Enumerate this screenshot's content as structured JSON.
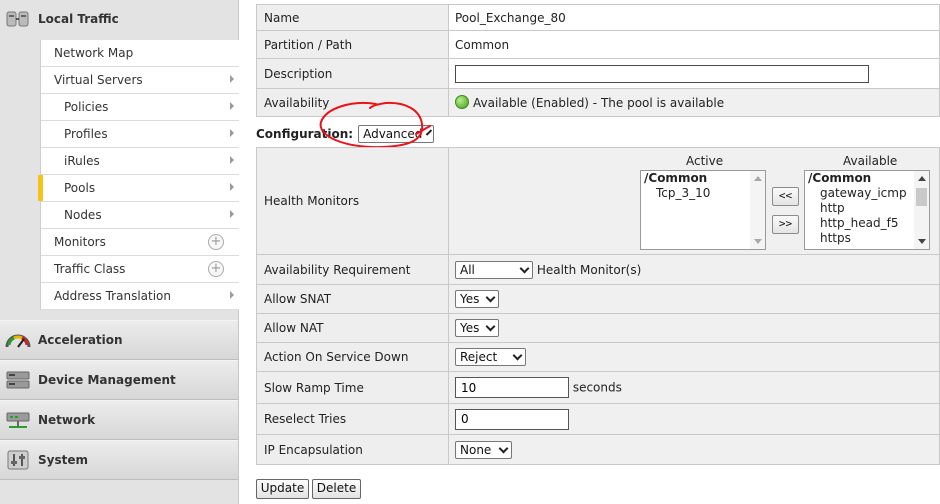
{
  "sidebar": {
    "local_traffic": "Local Traffic",
    "items": [
      {
        "label": "Network Map"
      },
      {
        "label": "Virtual Servers"
      },
      {
        "label": "Policies"
      },
      {
        "label": "Profiles"
      },
      {
        "label": "iRules"
      },
      {
        "label": "Pools"
      },
      {
        "label": "Nodes"
      },
      {
        "label": "Monitors"
      },
      {
        "label": "Traffic Class"
      },
      {
        "label": "Address Translation"
      }
    ],
    "sections": [
      {
        "label": "Acceleration"
      },
      {
        "label": "Device Management"
      },
      {
        "label": "Network"
      },
      {
        "label": "System"
      }
    ]
  },
  "properties": {
    "name_label": "Name",
    "name_value": "Pool_Exchange_80",
    "partition_label": "Partition / Path",
    "partition_value": "Common",
    "description_label": "Description",
    "description_value": "",
    "availability_label": "Availability",
    "availability_value": "Available (Enabled) - The pool is available"
  },
  "configuration": {
    "label": "Configuration:",
    "mode": "Advanced",
    "health_monitors_label": "Health Monitors",
    "active_header": "Active",
    "available_header": "Available",
    "active_partition": "/Common",
    "active_items": [
      "Tcp_3_10"
    ],
    "available_partition": "/Common",
    "available_items": [
      "gateway_icmp",
      "http",
      "http_head_f5",
      "https"
    ],
    "move_left": "<<",
    "move_right": ">>",
    "availability_requirement_label": "Availability Requirement",
    "availability_requirement_value": "All",
    "availability_requirement_suffix": "Health Monitor(s)",
    "allow_snat_label": "Allow SNAT",
    "allow_snat_value": "Yes",
    "allow_nat_label": "Allow NAT",
    "allow_nat_value": "Yes",
    "action_down_label": "Action On Service Down",
    "action_down_value": "Reject",
    "slow_ramp_label": "Slow Ramp Time",
    "slow_ramp_value": "10",
    "slow_ramp_unit": "seconds",
    "reselect_label": "Reselect Tries",
    "reselect_value": "0",
    "ip_encap_label": "IP Encapsulation",
    "ip_encap_value": "None"
  },
  "actions": {
    "update": "Update",
    "delete": "Delete"
  },
  "colors": {
    "annotation": "#e8141a",
    "active_marker": "#f2c318",
    "status_green": "#3f9a18"
  }
}
